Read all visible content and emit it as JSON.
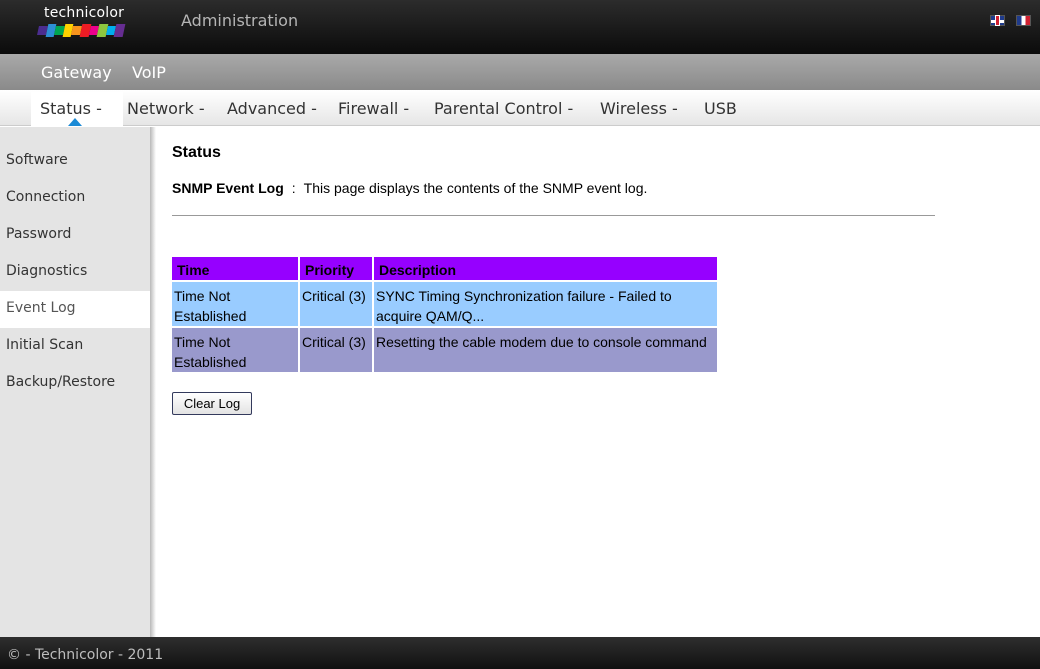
{
  "header": {
    "logo_text": "technicolor",
    "logo_colors": [
      "#4b2d8f",
      "#2d8fd5",
      "#00a651",
      "#ffd200",
      "#f7941d",
      "#ed1c24",
      "#ec008c",
      "#8dc63f",
      "#00aeef",
      "#662d91"
    ],
    "title": "Administration",
    "flags": [
      "english-flag-icon",
      "french-flag-icon"
    ]
  },
  "main_nav": {
    "items": [
      "Gateway",
      "VoIP"
    ]
  },
  "sub_nav": {
    "items": [
      "Status -",
      "Network -",
      "Advanced -",
      "Firewall -",
      "Parental Control -",
      "Wireless -",
      "USB"
    ],
    "active": "Status -",
    "active_indicator_color": "#1a8ad6"
  },
  "sidebar": {
    "items": [
      "Software",
      "Connection",
      "Password",
      "Diagnostics",
      "Event Log",
      "Initial Scan",
      "Backup/Restore"
    ],
    "active": "Event Log"
  },
  "page": {
    "title": "Status",
    "desc_label": "SNMP Event Log",
    "desc_separator": ":",
    "desc_text": "This page displays the contents of the SNMP event log."
  },
  "log_table": {
    "headers": [
      "Time",
      "Priority",
      "Description"
    ],
    "header_color": "#9600ff",
    "rows": [
      {
        "time": "Time Not Established",
        "priority": "Critical (3)",
        "description": "SYNC Timing Synchronization failure - Failed to acquire QAM/Q..."
      },
      {
        "time": "Time Not Established",
        "priority": "Critical (3)",
        "description": "Resetting the cable modem due to console command"
      }
    ],
    "row_colors": [
      "#99ccff",
      "#9999cc"
    ]
  },
  "buttons": {
    "clear_log": "Clear Log"
  },
  "footer": {
    "text": "© - Technicolor - 2011"
  }
}
